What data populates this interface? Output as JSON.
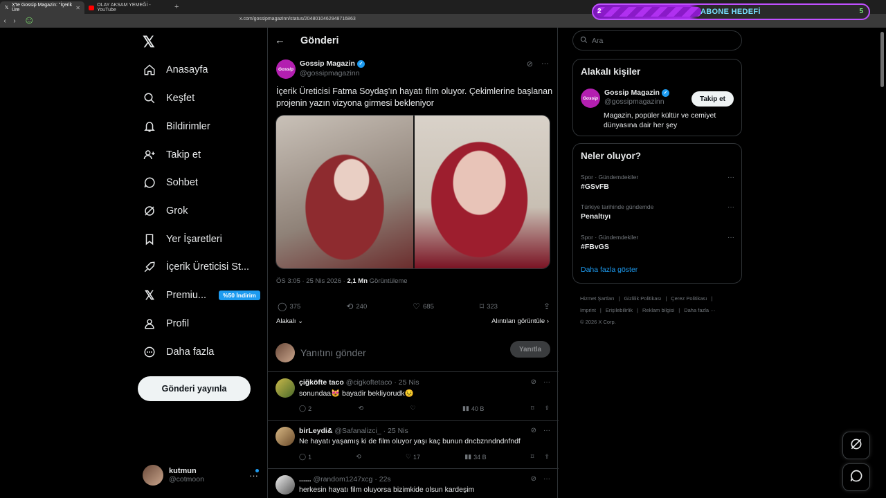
{
  "browser": {
    "tabs": [
      {
        "label": "X'te Gossip Magazin: \"İçerik Üre",
        "active": true,
        "icon": "x-logo-icon"
      },
      {
        "label": "OLAY AKSAM YEMEĞİ - YouTube",
        "active": false,
        "icon": "youtube-icon"
      }
    ],
    "url": "x.com/gossipmagazinn/status/2048010462948716863",
    "overlay": {
      "left_number": "2",
      "label": "ABONE HEDEFİ",
      "right_number": "5"
    }
  },
  "nav": {
    "items": [
      {
        "label": "Anasayfa",
        "icon": "home-icon"
      },
      {
        "label": "Keşfet",
        "icon": "search-icon"
      },
      {
        "label": "Bildirimler",
        "icon": "bell-icon"
      },
      {
        "label": "Takip et",
        "icon": "add-person-icon"
      },
      {
        "label": "Sohbet",
        "icon": "chat-icon"
      },
      {
        "label": "Grok",
        "icon": "grok-icon"
      },
      {
        "label": "Yer İşaretleri",
        "icon": "bookmark-icon"
      },
      {
        "label": "İçerik Üreticisi St...",
        "icon": "rocket-icon"
      },
      {
        "label": "Premiu...",
        "icon": "x-logo-icon",
        "badge": "%50 İndirim"
      },
      {
        "label": "Profil",
        "icon": "person-icon"
      },
      {
        "label": "Daha fazla",
        "icon": "more-circle-icon"
      }
    ],
    "post_button": "Gönderi yayınla",
    "account": {
      "name": "kutmun",
      "handle": "@cotmoon"
    }
  },
  "post": {
    "header_title": "Gönderi",
    "author_name": "Gossip Magazin",
    "author_handle": "@gossipmagazinn",
    "avatar_text": "Gossip",
    "text": "İçerik Üreticisi Fatma Soydaş'ın hayatı film oluyor. Çekimlerine başlanan projenin yazın vizyona girmesi bekleniyor",
    "time": "ÖS 3:05 · 25 Nis 2026 · ",
    "views_count": "2,1 Mn",
    "views_label": " Görüntüleme",
    "stats": {
      "replies": "375",
      "reposts": "240",
      "likes": "685",
      "bookmarks": "323"
    },
    "sort_label": "Alakalı",
    "quotes_label": "Alıntıları görüntüle",
    "reply_placeholder": "Yanıtını gönder",
    "reply_button": "Yanıtla"
  },
  "replies": [
    {
      "name": "çiğköfte taco",
      "handle": "@cigkoftetaco",
      "date": "· 25 Nis",
      "text": "sonundaa😻 bayadir bekliyorudk😣",
      "replies": "2",
      "reposts": "",
      "likes": "",
      "views": "40 B"
    },
    {
      "name": "birLeydi&",
      "handle": "@Safanalizci_",
      "date": "· 25 Nis",
      "text": "Ne hayatı yaşamış ki de film oluyor yaşı kaç bunun dncbznndndnfndf",
      "replies": "1",
      "reposts": "",
      "likes": "17",
      "views": "34 B"
    },
    {
      "name": "......",
      "handle": "@random1247xcg",
      "date": "· 22s",
      "text": "herkesin hayatı film oluyorsa bizimkide olsun kardeşim",
      "replies": "",
      "reposts": "",
      "likes": "",
      "views": ""
    }
  ],
  "right": {
    "search_placeholder": "Ara",
    "related_title": "Alakalı kişiler",
    "related_person": {
      "name": "Gossip Magazin",
      "handle": "@gossipmagazinn",
      "bio": "Magazin, popüler kültür ve cemiyet dünyasına dair her şey",
      "follow_label": "Takip et"
    },
    "trends_title": "Neler oluyor?",
    "trends": [
      {
        "category": "Spor · Gündemdekiler",
        "name": "#GSvFB"
      },
      {
        "category": "Türkiye tarihinde gündemde",
        "name": "Penaltıyı"
      },
      {
        "category": "Spor · Gündemdekiler",
        "name": "#FBvGS"
      }
    ],
    "show_more": "Daha fazla göster",
    "footer_links": [
      "Hizmet Şartları",
      "Gizlilik Politikası",
      "Çerez Politikası",
      "Imprint",
      "Erişilebilirlik",
      "Reklam bilgisi",
      "Daha fazla ···"
    ],
    "copyright": "© 2026 X Corp."
  },
  "colors": {
    "accent": "#1d9bf0",
    "background": "#000000",
    "border": "#2f3336",
    "muted": "#71767b"
  }
}
